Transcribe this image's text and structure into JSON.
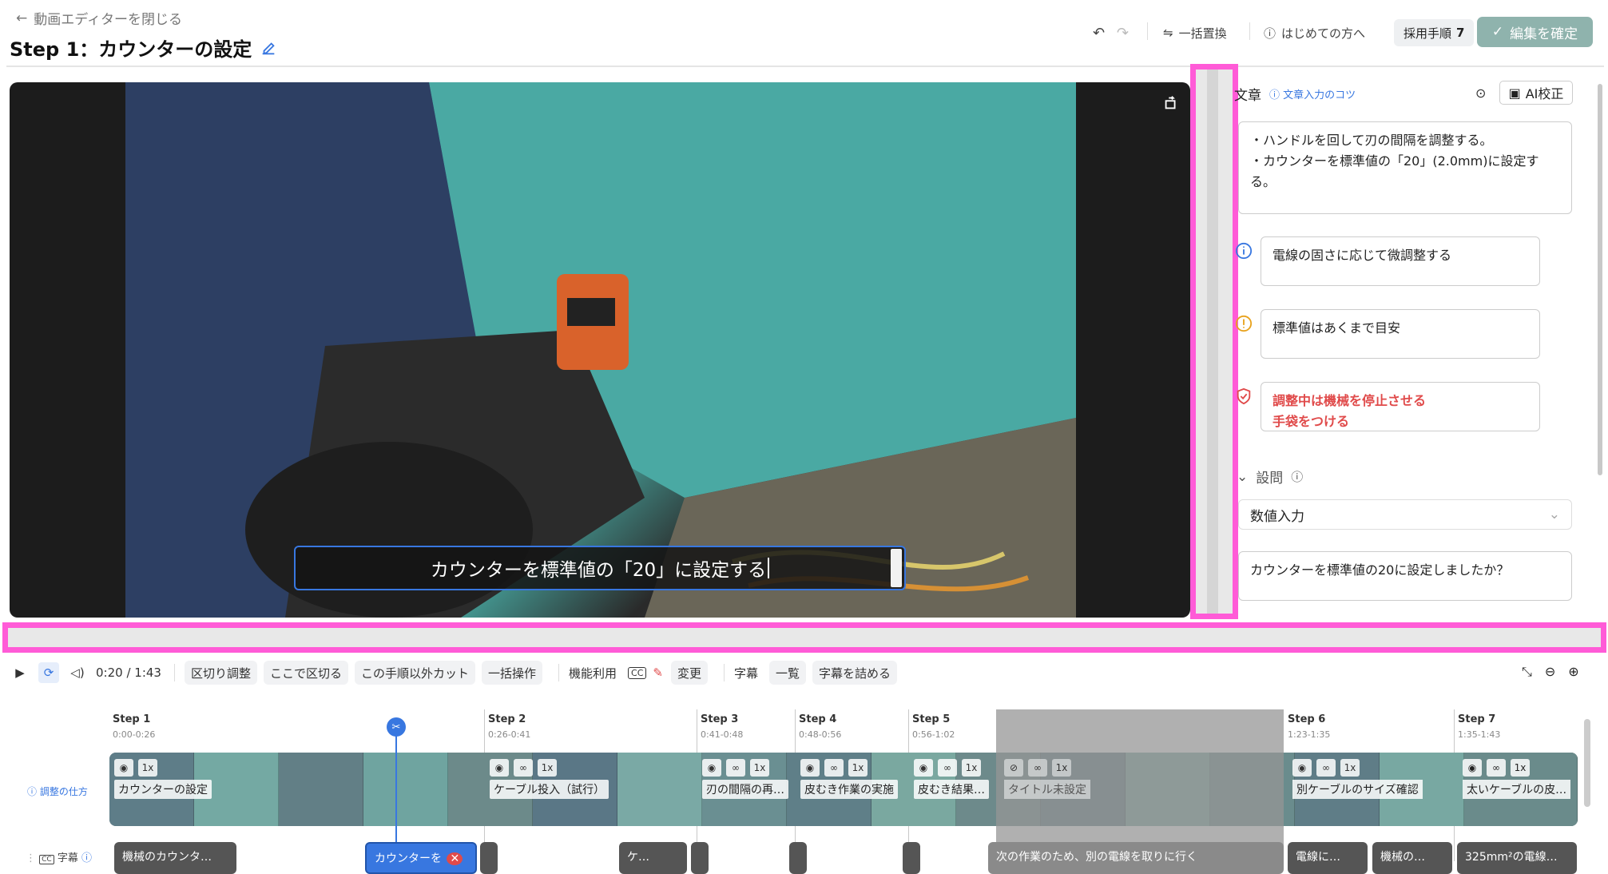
{
  "header": {
    "back_label": "動画エディターを閉じる",
    "title": "Step 1：カウンターの設定",
    "bulk_replace": "一括置換",
    "first_time": "はじめての方へ",
    "adopted_label": "採用手順",
    "adopted_count": "7",
    "confirm_label": "編集を確定"
  },
  "video": {
    "subtitle_text": "カウンターを標準値の「20」に設定する"
  },
  "right_panel": {
    "section_title": "文章",
    "tip_link": "文章入力のコツ",
    "ai_button": "AI校正",
    "body_text": "・ハンドルを回して刃の間隔を調整する。\n・カウンターを標準値の「20」(2.0mm)に設定する。",
    "note_info": "電線の固さに応じて微調整する",
    "note_warning": "標準値はあくまで目安",
    "note_safety": "調整中は機械を停止させる\n手袋をつける",
    "question_section": "設問",
    "question_type": "数値入力",
    "question_text": "カウンターを標準値の20に設定しましたか？"
  },
  "toolbar": {
    "time": "0:20 / 1:43",
    "btn_segment_adjust": "区切り調整",
    "btn_cut_here": "ここで区切る",
    "btn_cut_others": "この手順以外カット",
    "btn_bulk": "一括操作",
    "feature_label": "機能利用",
    "cc_label": "CC",
    "btn_change": "変更",
    "subtitle_label": "字幕",
    "btn_list": "一覧",
    "btn_pack": "字幕を詰める"
  },
  "timeline": {
    "helper_link": "調整の仕方",
    "subtitle_row_label": "字幕",
    "steps": [
      {
        "name": "Step 1",
        "range": "0:00-0:26",
        "label": "カウンターの設定",
        "speed": "1x"
      },
      {
        "name": "Step 2",
        "range": "0:26-0:41",
        "label": "ケーブル投入（試行）",
        "speed": "1x"
      },
      {
        "name": "Step 3",
        "range": "0:41-0:48",
        "label": "刃の間隔の再…",
        "speed": "1x"
      },
      {
        "name": "Step 4",
        "range": "0:48-0:56",
        "label": "皮むき作業の実施",
        "speed": "1x"
      },
      {
        "name": "Step 5",
        "range": "0:56-1:02",
        "label": "皮むき結果…",
        "speed": "1x"
      },
      {
        "name": "",
        "range": "",
        "label": "タイトル未設定",
        "speed": "1x"
      },
      {
        "name": "Step 6",
        "range": "1:23-1:35",
        "label": "別ケーブルのサイズ確認",
        "speed": "1x"
      },
      {
        "name": "Step 7",
        "range": "1:35-1:43",
        "label": "太いケーブルの皮…",
        "speed": "1x"
      }
    ],
    "subtitles": [
      "機械のカウンタ…",
      "カウンターを",
      "ケ…",
      "次の作業のため、別の電線を取りに行く",
      "電線に…",
      "機械の…",
      "325mm²の電線…"
    ]
  },
  "colors": {
    "accent": "#3877e0",
    "highlight": "#ff5bd7",
    "confirm_bg": "#8fb3ad",
    "danger": "#e04a4a",
    "warning": "#e8a21c"
  }
}
